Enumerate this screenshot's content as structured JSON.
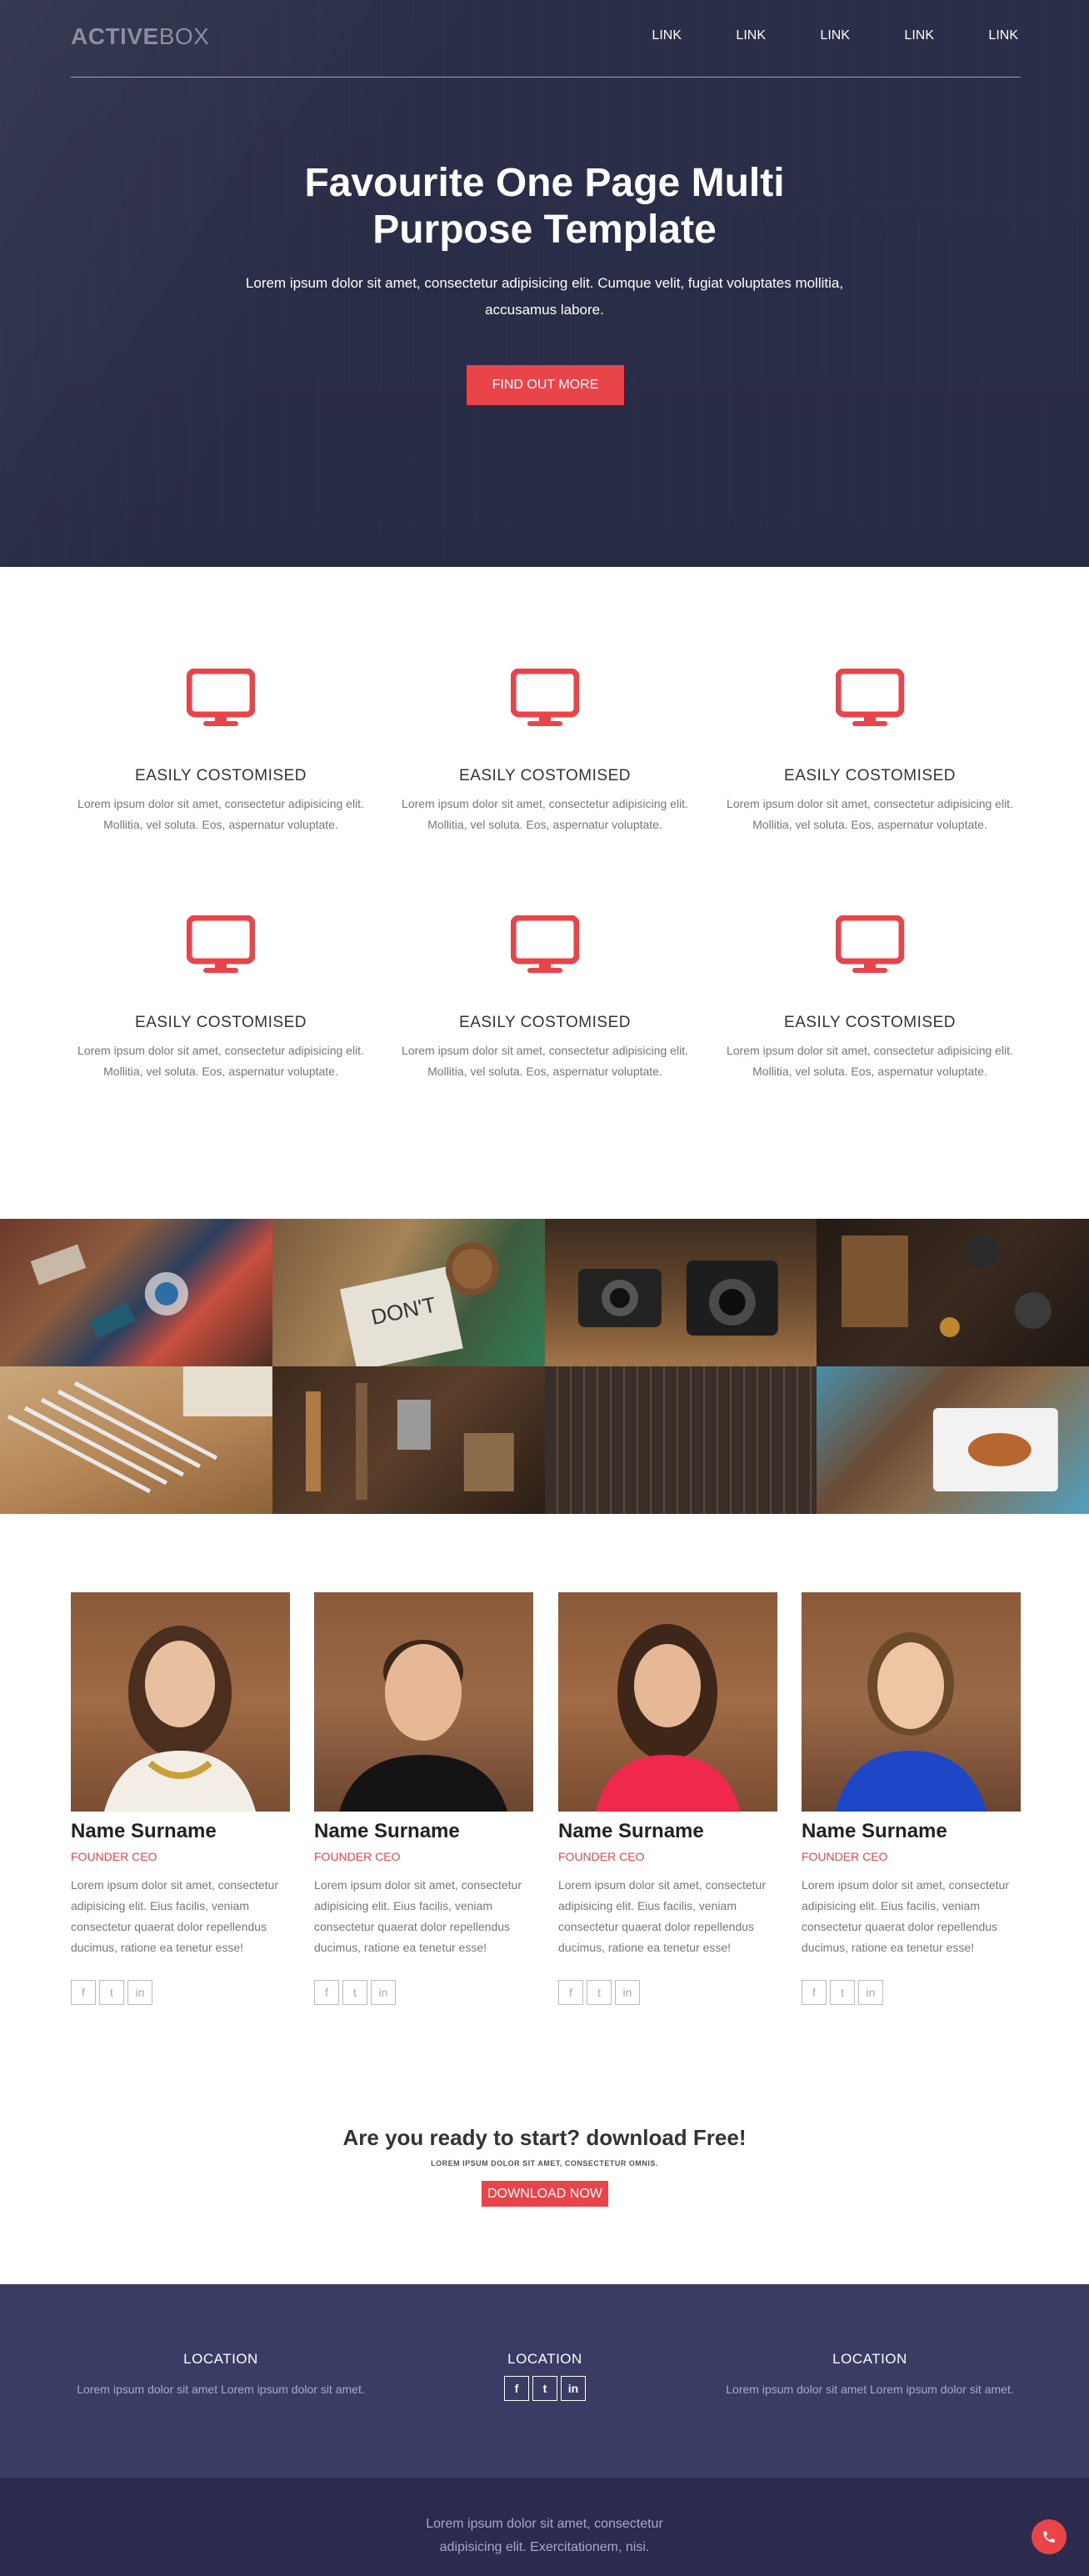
{
  "header": {
    "logo_bold": "ACTIVE",
    "logo_light": "BOX",
    "nav": [
      "LINK",
      "LINK",
      "LINK",
      "LINK",
      "LINK"
    ]
  },
  "hero": {
    "title_line1": "Favourite One Page Multi",
    "title_line2": "Purpose Template",
    "subtitle": "Lorem ipsum dolor sit amet, consectetur adipisicing elit. Cumque velit, fugiat voluptates mollitia, accusamus labore.",
    "cta": "FIND OUT MORE"
  },
  "features": [
    {
      "icon": "monitor-icon",
      "title": "EASILY COSTOMISED",
      "text_line1": "Lorem ipsum dolor sit amet, consectetur adipisicing elit.",
      "text_line2": "Mollitia, vel soluta. Eos, aspernatur voluptate."
    },
    {
      "icon": "monitor-icon",
      "title": "EASILY COSTOMISED",
      "text_line1": "Lorem ipsum dolor sit amet, consectetur adipisicing elit.",
      "text_line2": "Mollitia, vel soluta. Eos, aspernatur voluptate."
    },
    {
      "icon": "monitor-icon",
      "title": "EASILY COSTOMISED",
      "text_line1": "Lorem ipsum dolor sit amet, consectetur adipisicing elit.",
      "text_line2": "Mollitia, vel soluta. Eos, aspernatur voluptate."
    },
    {
      "icon": "monitor-icon",
      "title": "EASILY COSTOMISED",
      "text_line1": "Lorem ipsum dolor sit amet, consectetur adipisicing elit.",
      "text_line2": "Mollitia, vel soluta. Eos, aspernatur voluptate."
    },
    {
      "icon": "monitor-icon",
      "title": "EASILY COSTOMISED",
      "text_line1": "Lorem ipsum dolor sit amet, consectetur adipisicing elit.",
      "text_line2": "Mollitia, vel soluta. Eos, aspernatur voluptate."
    },
    {
      "icon": "monitor-icon",
      "title": "EASILY COSTOMISED",
      "text_line1": "Lorem ipsum dolor sit amet, consectetur adipisicing elit.",
      "text_line2": "Mollitia, vel soluta. Eos, aspernatur voluptate."
    }
  ],
  "team": [
    {
      "name": "Name Surname",
      "role": "FOUNDER CEO",
      "bio": "Lorem ipsum dolor sit amet, consectetur adipisicing elit. Eius facilis, veniam consectetur quaerat dolor repellendus ducimus, ratione ea tenetur esse!"
    },
    {
      "name": "Name Surname",
      "role": "FOUNDER CEO",
      "bio": "Lorem ipsum dolor sit amet, consectetur adipisicing elit. Eius facilis, veniam consectetur quaerat dolor repellendus ducimus, ratione ea tenetur esse!"
    },
    {
      "name": "Name Surname",
      "role": "FOUNDER CEO",
      "bio": "Lorem ipsum dolor sit amet, consectetur adipisicing elit. Eius facilis, veniam consectetur quaerat dolor repellendus ducimus, ratione ea tenetur esse!"
    },
    {
      "name": "Name Surname",
      "role": "FOUNDER CEO",
      "bio": "Lorem ipsum dolor sit amet, consectetur adipisicing elit. Eius facilis, veniam consectetur quaerat dolor repellendus ducimus, ratione ea tenetur esse!"
    }
  ],
  "social_icons": {
    "facebook": "f",
    "twitter": "t",
    "linkedin": "in"
  },
  "cta": {
    "title": "Are you ready to start? download Free!",
    "subtitle": "LOREM IPSUM DOLOR SIT AMET, CONSECTETUR OMNIS.",
    "button": "DOWNLOAD NOW"
  },
  "footer": {
    "col1_title": "LOCATION",
    "col1_text": "Lorem ipsum dolor sit amet Lorem ipsum dolor sit amet.",
    "col2_title": "LOCATION",
    "col3_title": "LOCATION",
    "col3_text": "Lorem ipsum dolor sit amet Lorem ipsum dolor sit amet.",
    "bottom_line1": "Lorem ipsum dolor sit amet, consectetur",
    "bottom_line2": "adipisicing elit. Exercitationem, nisi."
  },
  "colors": {
    "accent": "#e9444a",
    "hero_bg": "#2b2e48",
    "footer_top": "#3b3c66",
    "footer_bottom": "#2b2c4d"
  }
}
